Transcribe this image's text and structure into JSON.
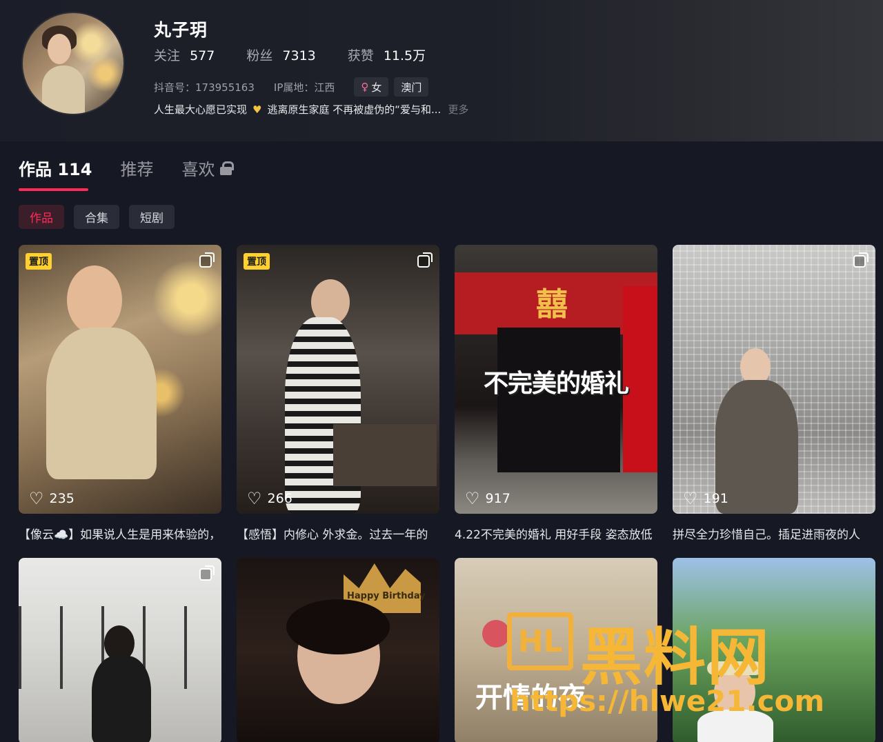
{
  "profile": {
    "name": "丸子玥",
    "stats": [
      {
        "label": "关注",
        "value": "577"
      },
      {
        "label": "粉丝",
        "value": "7313"
      },
      {
        "label": "获赞",
        "value": "11.5万"
      }
    ],
    "uid": "抖音号：173955163",
    "ip": "IP属地：江西",
    "gender_chip": "女",
    "location_chip": "澳门",
    "bio_part1": "人生最大心愿已实现",
    "bio_part2": "逃离原生家庭 不再被虚伪的“爱与和...",
    "bio_more": "更多"
  },
  "tabs": [
    {
      "label": "作品 114",
      "active": true
    },
    {
      "label": "推荐",
      "active": false
    },
    {
      "label": "喜欢",
      "active": false,
      "locked": true
    }
  ],
  "subtabs": [
    {
      "label": "作品",
      "active": true
    },
    {
      "label": "合集",
      "active": false
    },
    {
      "label": "短剧",
      "active": false
    }
  ],
  "videos": [
    {
      "pinned": true,
      "pin_label": "置顶",
      "likes": "235",
      "caption": "【像云☁️】如果说人生是用来体验的，"
    },
    {
      "pinned": true,
      "pin_label": "置顶",
      "likes": "266",
      "caption": "【感悟】内修心 外求金。过去一年的"
    },
    {
      "pinned": false,
      "likes": "917",
      "overlay": "不完美的婚礼",
      "caption": "4.22不完美的婚礼 用好手段 姿态放低"
    },
    {
      "pinned": false,
      "likes": "191",
      "caption": "拼尽全力珍惜自己。插足进雨夜的人"
    },
    {
      "overlay": ""
    },
    {
      "overlay": "Happy Birthday"
    },
    {
      "overlay": "开情的夜"
    },
    {
      "overlay": ""
    }
  ],
  "watermark": {
    "logo": "HL",
    "title": "黑料网",
    "url": "https://hlwe21.com"
  },
  "colors": {
    "background": "#161823",
    "accent": "#fe2c55",
    "pin_badge": "#ffd02e",
    "watermark": "#f5b735"
  }
}
